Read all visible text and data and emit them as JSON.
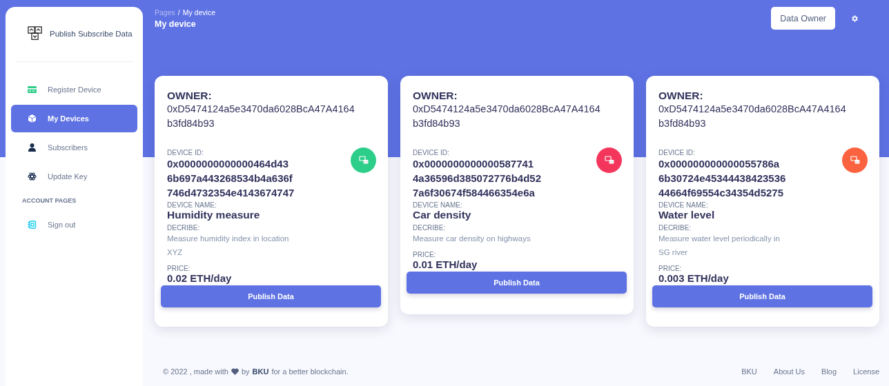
{
  "sidebar": {
    "brand": "Publish Subscribe Data",
    "items": [
      {
        "kind": "item",
        "label": "Register Device",
        "selected": false
      },
      {
        "kind": "item",
        "label": "My Devices",
        "selected": true
      },
      {
        "kind": "item",
        "label": "Subscribers",
        "selected": false
      },
      {
        "kind": "item",
        "label": "Update Key",
        "selected": false
      },
      {
        "kind": "heading",
        "label": "ACCOUNT PAGES"
      },
      {
        "kind": "item",
        "label": "Sign out",
        "selected": false
      }
    ]
  },
  "header": {
    "breadcrumb": [
      "Pages",
      "My device"
    ],
    "separator": "/",
    "title": "My device",
    "role_button": "Data Owner"
  },
  "devices": [
    {
      "owner_label": "OWNER:",
      "owner": "0xD5474124a5e3470da6028BcA47A4164 b3fd84b93",
      "id_label": "DEVICE ID:",
      "id": "0x0000000000000464d43 6b697a443268534b4a636f 746d4732354e4143674747",
      "name_label": "DEVICE NAME:",
      "name": "Humidity measure",
      "describe_label": "DECRIBE:",
      "describe": "Measure humidity index in location XYZ",
      "price_label": "PRICE:",
      "price": "0.02 ETH/day",
      "button": "Publish Data",
      "color": "#2dce89"
    },
    {
      "owner_label": "OWNER:",
      "owner": "0xD5474124a5e3470da6028BcA47A4164 b3fd84b93",
      "id_label": "DEVICE ID:",
      "id": "0x0000000000000587741 4a36596d385072776b4d52 7a6f30674f584466354e6a",
      "name_label": "DEVICE NAME:",
      "name": "Car density",
      "describe_label": "DECRIBE:",
      "describe": "Measure car density on highways",
      "price_label": "PRICE:",
      "price": "0.01 ETH/day",
      "button": "Publish Data",
      "color": "#f5365c"
    },
    {
      "owner_label": "OWNER:",
      "owner": "0xD5474124a5e3470da6028BcA47A4164 b3fd84b93",
      "id_label": "DEVICE ID:",
      "id": "0x000000000000055786a 6b30724e45344438423536 44664f69554c34354d5275",
      "name_label": "DEVICE NAME:",
      "name": "Water level",
      "describe_label": "DECRIBE:",
      "describe": "Measure water level periodically in SG river",
      "price_label": "PRICE:",
      "price": "0.003 ETH/day",
      "button": "Publish Data",
      "color": "#fb6340"
    }
  ],
  "footer": {
    "prefix": "© 2022 , made with",
    "by": "by",
    "author_link": "BKU",
    "suffix": "for a better blockchain.",
    "links": [
      "BKU",
      "About Us",
      "Blog",
      "License"
    ]
  }
}
